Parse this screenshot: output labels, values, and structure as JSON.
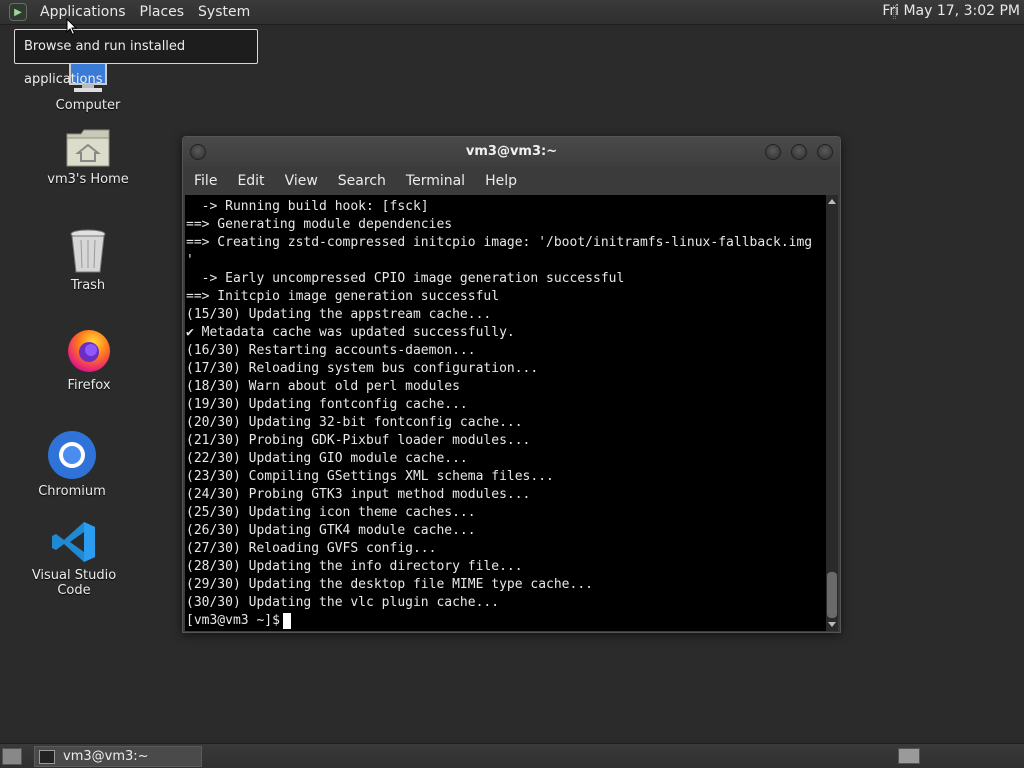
{
  "top_panel": {
    "menus": [
      "Applications",
      "Places",
      "System"
    ],
    "clock": "Fri May 17,  3:02 PM"
  },
  "tooltip": "Browse and run installed applications",
  "desktop_icons": {
    "computer": "Computer",
    "home": "vm3's Home",
    "trash": "Trash",
    "firefox": "Firefox",
    "chromium": "Chromium",
    "vscode": "Visual Studio Code"
  },
  "terminal": {
    "title": "vm3@vm3:~",
    "menus": [
      "File",
      "Edit",
      "View",
      "Search",
      "Terminal",
      "Help"
    ],
    "lines": [
      "  -> Running build hook: [fsck]",
      "==> Generating module dependencies",
      "==> Creating zstd-compressed initcpio image: '/boot/initramfs-linux-fallback.img",
      "'",
      "  -> Early uncompressed CPIO image generation successful",
      "==> Initcpio image generation successful",
      "(15/30) Updating the appstream cache...",
      "✔ Metadata cache was updated successfully.",
      "(16/30) Restarting accounts-daemon...",
      "(17/30) Reloading system bus configuration...",
      "(18/30) Warn about old perl modules",
      "(19/30) Updating fontconfig cache...",
      "(20/30) Updating 32-bit fontconfig cache...",
      "(21/30) Probing GDK-Pixbuf loader modules...",
      "(22/30) Updating GIO module cache...",
      "(23/30) Compiling GSettings XML schema files...",
      "(24/30) Probing GTK3 input method modules...",
      "(25/30) Updating icon theme caches...",
      "(26/30) Updating GTK4 module cache...",
      "(27/30) Reloading GVFS config...",
      "(28/30) Updating the info directory file...",
      "(29/30) Updating the desktop file MIME type cache...",
      "(30/30) Updating the vlc plugin cache..."
    ],
    "prompt": "[vm3@vm3 ~]$"
  },
  "taskbar": {
    "task_label": "vm3@vm3:~"
  }
}
